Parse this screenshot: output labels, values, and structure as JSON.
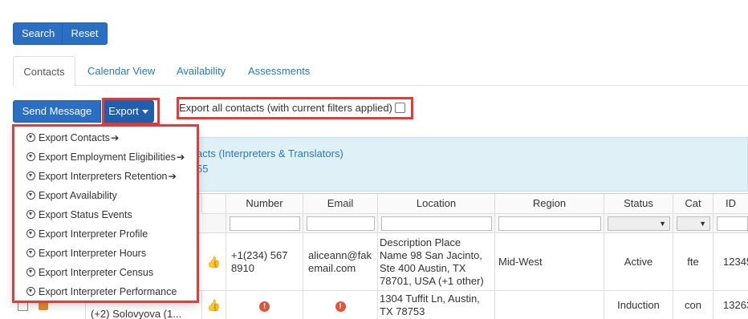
{
  "search": {
    "search_label": "Search",
    "reset_label": "Reset"
  },
  "tabs": [
    {
      "label": "Contacts",
      "active": true
    },
    {
      "label": "Calendar View",
      "active": false
    },
    {
      "label": "Availability",
      "active": false
    },
    {
      "label": "Assessments",
      "active": false
    }
  ],
  "actions": {
    "send_message_label": "Send Message",
    "export_label": "Export",
    "export_all_label": "Export all contacts (with current filters applied)",
    "export_all_checked": false
  },
  "export_menu": {
    "items": [
      {
        "label": "Export Contacts",
        "arrow": "🡲"
      },
      {
        "label": "Export Employment Eligibilities",
        "arrow": "🡲"
      },
      {
        "label": "Export Interpreters Retention",
        "arrow": "🡲"
      },
      {
        "label": "Export Availability",
        "arrow": ""
      },
      {
        "label": "Export Status Events",
        "arrow": ""
      },
      {
        "label": "Export Interpreter Profile",
        "arrow": ""
      },
      {
        "label": "Export Interpreter Hours",
        "arrow": ""
      },
      {
        "label": "Export Interpreter Census",
        "arrow": ""
      },
      {
        "label": "Export Interpreter Performance",
        "arrow": ""
      }
    ]
  },
  "info": {
    "line1": "acts (Interpreters & Translators)",
    "line2": "55"
  },
  "table": {
    "headers": {
      "number": "Number",
      "email": "Email",
      "location": "Location",
      "region": "Region",
      "status": "Status",
      "cat": "Cat",
      "id": "ID"
    },
    "rows": [
      {
        "number": "+1(234) 567 8910",
        "email": "aliceann@fakemail.com",
        "location": "Description Place Name 98 San Jacinto, Ste 400 Austin, TX 78701, USA (+1 other)",
        "region": "Mid-West",
        "status": "Active",
        "cat": "fte",
        "id": "12345"
      },
      {
        "name": "(+2) Solovyova (1...",
        "number": "!",
        "email": "!",
        "location": "1304 Tuffit Ln, Austin, TX 78753",
        "region": "",
        "status": "Induction",
        "cat": "con",
        "id": "13263"
      }
    ]
  },
  "colors": {
    "primary": "#2a6fc3",
    "highlight": "#e23b3b",
    "info_bg": "#dff0f7",
    "link": "#2a7ab8"
  }
}
